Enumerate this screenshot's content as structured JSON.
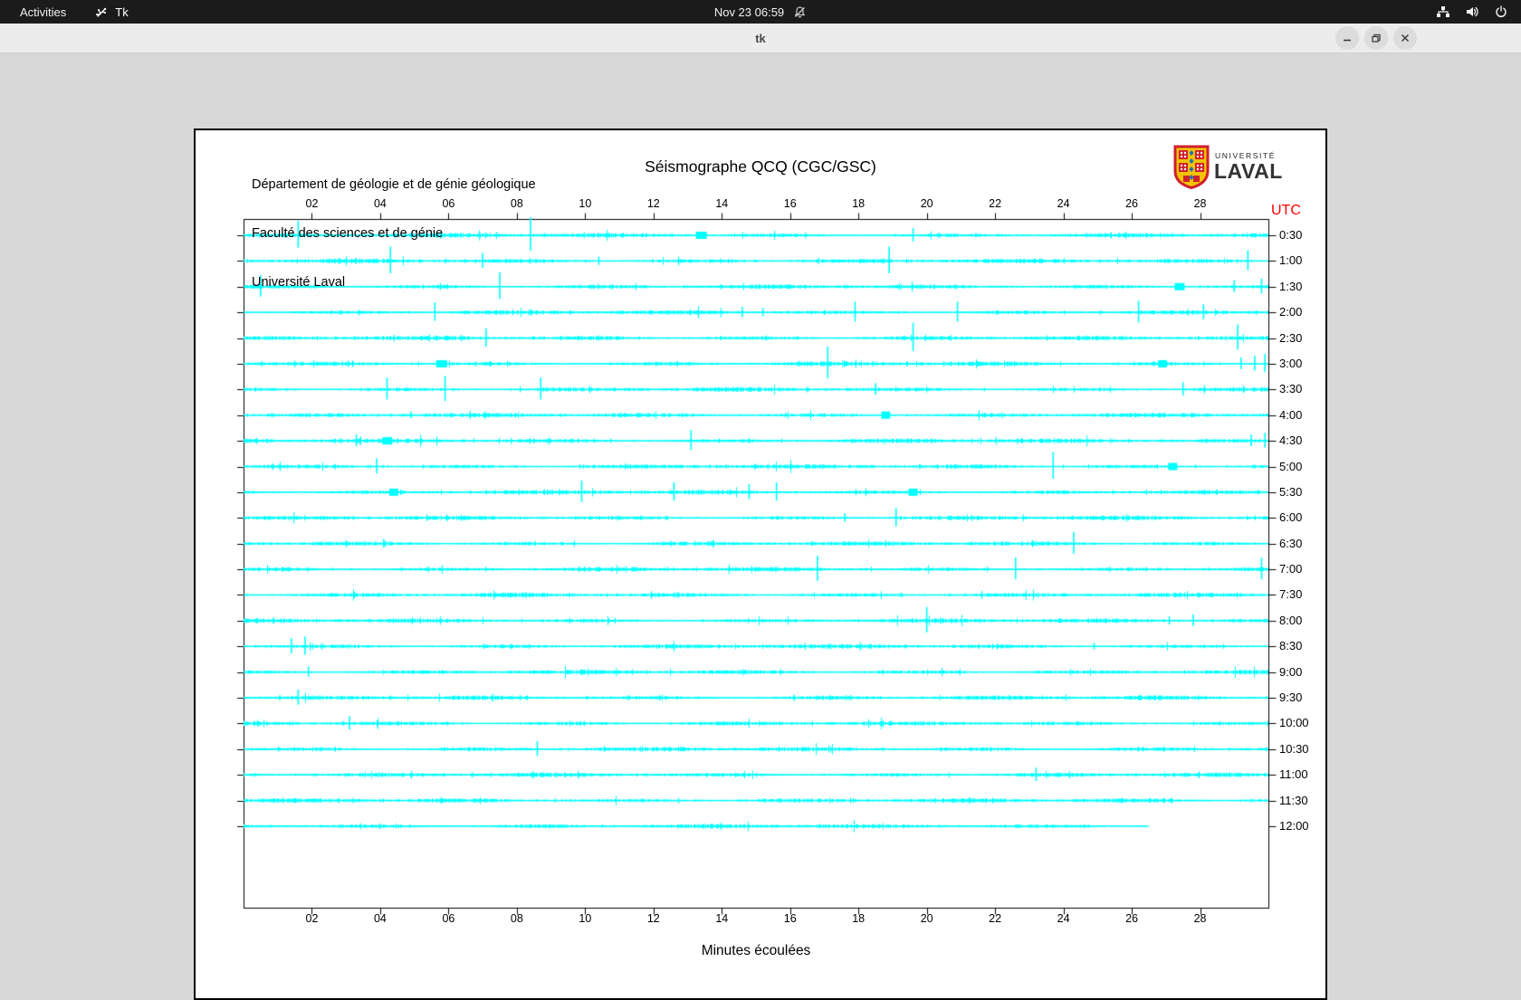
{
  "desktop": {
    "activities_label": "Activities",
    "app_indicator": "Tk",
    "clock": "Nov 23  06:59"
  },
  "window": {
    "title": "tk"
  },
  "doc": {
    "institution_lines": [
      "Département de géologie et de génie géologique",
      "Faculté des sciences et de génie",
      "Université Laval"
    ],
    "title": "Séismographe QCQ (CGC/GSC)",
    "logo_line1": "UNIVERSITÉ",
    "logo_line2": "LAVAL",
    "utc_label": "UTC",
    "xlabel": "Minutes écoulées"
  },
  "chart_data": {
    "type": "line",
    "subtype": "helicorder-seismogram",
    "title": "Séismographe QCQ (CGC/GSC)",
    "xlabel": "Minutes écoulées",
    "right_axis_title": "UTC",
    "x_range": [
      0,
      30
    ],
    "x_tick_minutes": [
      2,
      4,
      6,
      8,
      10,
      12,
      14,
      16,
      18,
      20,
      22,
      24,
      26,
      28
    ],
    "x_ticks": [
      "02",
      "04",
      "06",
      "08",
      "10",
      "12",
      "14",
      "16",
      "18",
      "20",
      "22",
      "24",
      "26",
      "28"
    ],
    "grid": false,
    "trace_color": "#00ffff",
    "frame_color": "#000000",
    "traces": [
      {
        "utc": "0:30",
        "end_min": 30,
        "events": [
          [
            1.6,
            16
          ],
          [
            8.4,
            20
          ],
          [
            13.4,
            4,
            12
          ],
          [
            19.6,
            8
          ]
        ]
      },
      {
        "utc": "1:00",
        "end_min": 30,
        "events": [
          [
            4.3,
            16
          ],
          [
            7.0,
            9
          ],
          [
            10.4,
            5
          ],
          [
            18.9,
            16
          ],
          [
            29.4,
            12
          ]
        ]
      },
      {
        "utc": "1:30",
        "end_min": 30,
        "events": [
          [
            0.5,
            13
          ],
          [
            7.5,
            16
          ],
          [
            27.4,
            4,
            11
          ],
          [
            29.0,
            7
          ],
          [
            29.8,
            9
          ]
        ]
      },
      {
        "utc": "2:00",
        "end_min": 30,
        "events": [
          [
            5.6,
            11
          ],
          [
            14.6,
            6
          ],
          [
            15.2,
            5
          ],
          [
            17.9,
            12
          ],
          [
            20.9,
            12
          ],
          [
            26.2,
            13
          ],
          [
            28.1,
            9
          ]
        ]
      },
      {
        "utc": "2:30",
        "end_min": 30,
        "events": [
          [
            7.1,
            11
          ],
          [
            19.6,
            17
          ],
          [
            29.1,
            15
          ]
        ]
      },
      {
        "utc": "3:00",
        "end_min": 30,
        "events": [
          [
            5.8,
            4,
            12
          ],
          [
            17.1,
            19
          ],
          [
            26.9,
            4,
            10
          ],
          [
            29.2,
            7
          ],
          [
            29.6,
            9
          ],
          [
            29.9,
            11
          ]
        ]
      },
      {
        "utc": "3:30",
        "end_min": 30,
        "events": [
          [
            4.2,
            13
          ],
          [
            5.9,
            15
          ],
          [
            8.7,
            13
          ],
          [
            18.5,
            7
          ],
          [
            27.5,
            8
          ]
        ]
      },
      {
        "utc": "4:00",
        "end_min": 30,
        "events": [
          [
            4.9,
            4
          ],
          [
            18.8,
            4,
            10
          ]
        ]
      },
      {
        "utc": "4:30",
        "end_min": 30,
        "events": [
          [
            3.3,
            7
          ],
          [
            4.2,
            4,
            10
          ],
          [
            13.1,
            12
          ],
          [
            29.5,
            7
          ],
          [
            29.9,
            9
          ]
        ]
      },
      {
        "utc": "5:00",
        "end_min": 30,
        "events": [
          [
            3.9,
            9
          ],
          [
            23.7,
            16
          ],
          [
            27.2,
            4,
            10
          ]
        ]
      },
      {
        "utc": "5:30",
        "end_min": 30,
        "events": [
          [
            4.4,
            4,
            10
          ],
          [
            9.9,
            13
          ],
          [
            12.6,
            11
          ],
          [
            14.8,
            9
          ],
          [
            15.6,
            11
          ],
          [
            19.6,
            4,
            10
          ]
        ]
      },
      {
        "utc": "6:00",
        "end_min": 30,
        "events": [
          [
            17.6,
            5
          ],
          [
            19.1,
            11
          ]
        ]
      },
      {
        "utc": "6:30",
        "end_min": 30,
        "events": [
          [
            4.1,
            5
          ],
          [
            24.3,
            13
          ]
        ]
      },
      {
        "utc": "7:00",
        "end_min": 30,
        "events": [
          [
            16.8,
            15
          ],
          [
            22.6,
            13
          ],
          [
            29.8,
            13
          ]
        ]
      },
      {
        "utc": "7:30",
        "end_min": 30,
        "events": []
      },
      {
        "utc": "8:00",
        "end_min": 30,
        "events": [
          [
            20.0,
            15
          ],
          [
            27.1,
            5
          ],
          [
            27.8,
            7
          ]
        ]
      },
      {
        "utc": "8:30",
        "end_min": 30,
        "events": [
          [
            1.4,
            9
          ],
          [
            1.8,
            11
          ],
          [
            24.9,
            4
          ]
        ]
      },
      {
        "utc": "9:00",
        "end_min": 30,
        "events": [
          [
            1.9,
            6
          ]
        ]
      },
      {
        "utc": "9:30",
        "end_min": 30,
        "events": [
          [
            1.6,
            9
          ]
        ]
      },
      {
        "utc": "10:00",
        "end_min": 30,
        "events": [
          [
            3.1,
            8
          ]
        ]
      },
      {
        "utc": "10:30",
        "end_min": 30,
        "events": [
          [
            8.6,
            9
          ]
        ]
      },
      {
        "utc": "11:00",
        "end_min": 30,
        "events": [
          [
            23.2,
            8
          ]
        ]
      },
      {
        "utc": "11:30",
        "end_min": 30,
        "events": []
      },
      {
        "utc": "12:00",
        "end_min": 26.5,
        "events": []
      }
    ]
  }
}
